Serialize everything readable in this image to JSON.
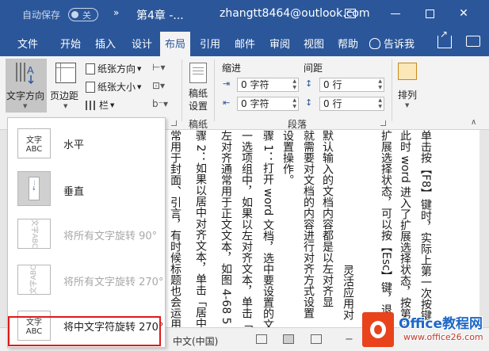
{
  "titlebar": {
    "autosave": "自动保存",
    "autosave_state": "关",
    "qa_more": "»",
    "doc_title": "第4章 -...",
    "account": "zhangtt8464@outlook.com"
  },
  "tabs": [
    {
      "label": "文件"
    },
    {
      "label": "开始"
    },
    {
      "label": "插入"
    },
    {
      "label": "设计"
    },
    {
      "label": "布局",
      "active": true
    },
    {
      "label": "引用"
    },
    {
      "label": "邮件"
    },
    {
      "label": "审阅"
    },
    {
      "label": "视图"
    },
    {
      "label": "帮助"
    }
  ],
  "tell_me": "告诉我",
  "ribbon": {
    "text_direction": "文字方向",
    "margins": "页边距",
    "orientation": "纸张方向",
    "size": "纸张大小",
    "columns": "栏",
    "draft_line1": "稿纸",
    "draft_line2": "设置",
    "draft_group": "稿纸",
    "indent": "缩进",
    "spacing": "间距",
    "indent_left": "0 字符",
    "indent_right": "0 字符",
    "spacing_before": "0 行",
    "spacing_after": "0 行",
    "paragraph_group": "段落",
    "arrange": "排列"
  },
  "menu": {
    "items": [
      {
        "label": "水平",
        "icon_text": "文字\nABC",
        "disabled": false
      },
      {
        "label": "垂直",
        "disabled": false
      },
      {
        "label": "将所有文字旋转 90°",
        "icon_text": "文字ABC",
        "disabled": true
      },
      {
        "label": "将所有文字旋转 270°",
        "icon_text": "文字ABC",
        "disabled": true
      },
      {
        "label": "将中文字符旋转 270°",
        "icon_text": "文字\nABC",
        "disabled": false,
        "highlighted": true
      }
    ]
  },
  "document": {
    "columns": [
      "常用于封面、引言，有时候标题也会运用",
      "骤 2：如果以居中对齐文本，单击「居中",
      "左对齐通常用于正文文本，如图 4-68 5",
      "一选项组中，如果以左对齐文本，单击「",
      "骤 1：打开 word 文档，选中要设置的文",
      "设置操作。",
      "就需要对文档的内容进行对齐方式设置",
      "默认输入的文档内容都是以左对齐显",
      "灵活应用对",
      "扩展选择状态，可以按【Esc】键，退出扩",
      "此时 word 进入了扩展选择状态，按第三次",
      "单击按【F8】键时，实际上第一次按键"
    ]
  },
  "statusbar": {
    "language": "中文(中国)"
  },
  "badge": {
    "title": "Office教程网",
    "url": "www.office26.com"
  }
}
